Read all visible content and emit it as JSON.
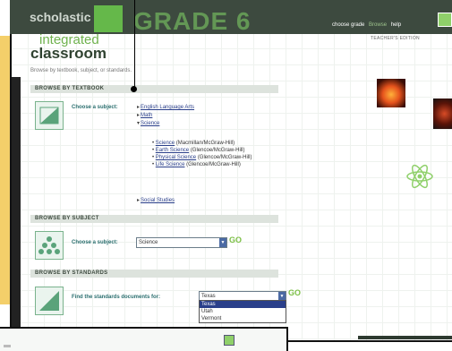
{
  "header": {
    "logo_small": "scholastic",
    "grade_label": "GRADE 6",
    "links": [
      "choose grade",
      "Browse",
      "help"
    ],
    "edition": "TEACHER'S EDITION"
  },
  "brand": {
    "integrated": "integrated",
    "classroom": "classroom",
    "browse_line": "Browse by textbook, subject, or standards."
  },
  "textbook_section": {
    "title": "BROWSE BY TEXTBOOK",
    "prompt": "Choose a subject:",
    "subjects": [
      "English Language Arts",
      "Math",
      "Science",
      "Social Studies"
    ],
    "science_books": [
      {
        "title": "Science",
        "publisher": "(Macmillan/McGraw-Hill)"
      },
      {
        "title": "Earth Science",
        "publisher": "(Glencoe/McGraw-Hill)"
      },
      {
        "title": "Physical Science",
        "publisher": "(Glencoe/McGraw-Hill)"
      },
      {
        "title": "Life Science",
        "publisher": "(Glencoe/McGraw-Hill)"
      }
    ]
  },
  "subject_section": {
    "title": "BROWSE BY SUBJECT",
    "prompt": "Choose a subject:",
    "selected": "Science",
    "go": "GO"
  },
  "standards_section": {
    "title": "BROWSE BY STANDARDS",
    "prompt": "Find the standards documents for:",
    "selected": "Texas",
    "options": [
      "Texas",
      "Utah",
      "Vermont"
    ],
    "go": "GO"
  },
  "colors": {
    "header_bg": "#3d4a3f",
    "accent_green": "#6fb24d",
    "link": "#2a3f8a",
    "yellow_bar": "#f4cf6a"
  }
}
